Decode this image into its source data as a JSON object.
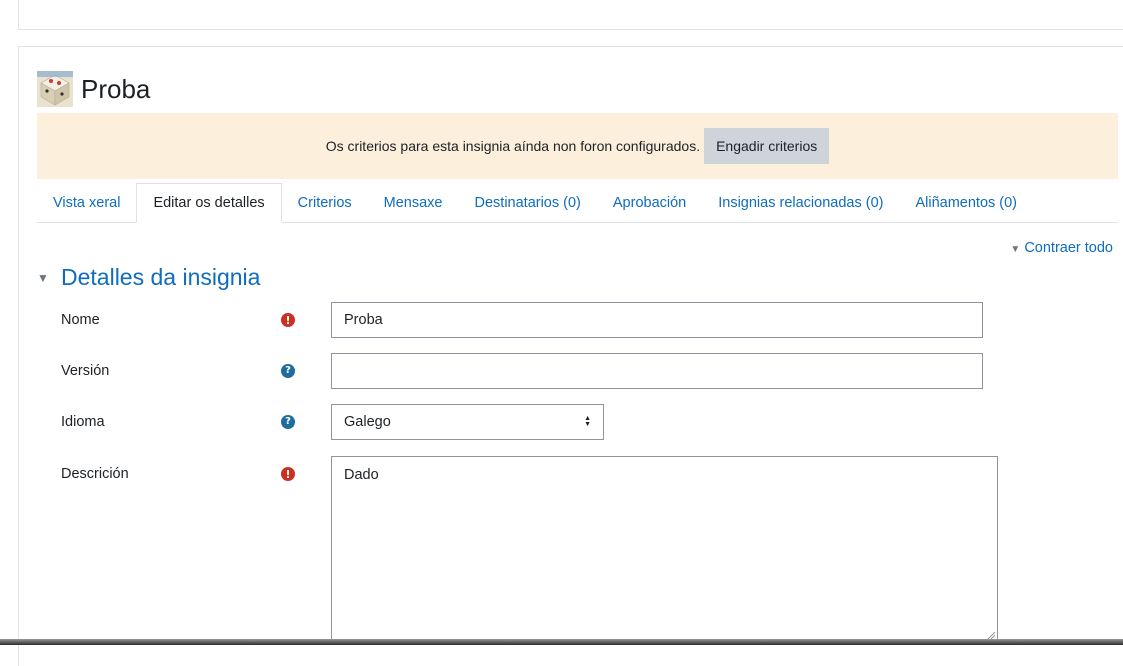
{
  "badge": {
    "name": "Proba"
  },
  "alert": {
    "message": "Os criterios para esta insignia aínda non foron configurados.",
    "button_label": "Engadir criterios"
  },
  "tabs": [
    {
      "label": "Vista xeral",
      "active": false
    },
    {
      "label": "Editar os detalles",
      "active": true
    },
    {
      "label": "Criterios",
      "active": false
    },
    {
      "label": "Mensaxe",
      "active": false
    },
    {
      "label": "Destinatarios (0)",
      "active": false
    },
    {
      "label": "Aprobación",
      "active": false
    },
    {
      "label": "Insignias relacionadas (0)",
      "active": false
    },
    {
      "label": "Aliñamentos (0)",
      "active": false
    }
  ],
  "collapse_all": "Contraer todo",
  "section": {
    "title": "Detalles da insignia"
  },
  "form": {
    "name": {
      "label": "Nome",
      "value": "Proba",
      "icon": "required-icon"
    },
    "version": {
      "label": "Versión",
      "value": "",
      "icon": "help-icon"
    },
    "language": {
      "label": "Idioma",
      "value": "Galego",
      "icon": "help-icon"
    },
    "description": {
      "label": "Descrición",
      "value": "Dado",
      "icon": "required-icon"
    }
  },
  "colors": {
    "link": "#0f6cbf",
    "alert_bg": "#fcefdc",
    "required": "#ca3120",
    "help": "#1f6d9b"
  }
}
